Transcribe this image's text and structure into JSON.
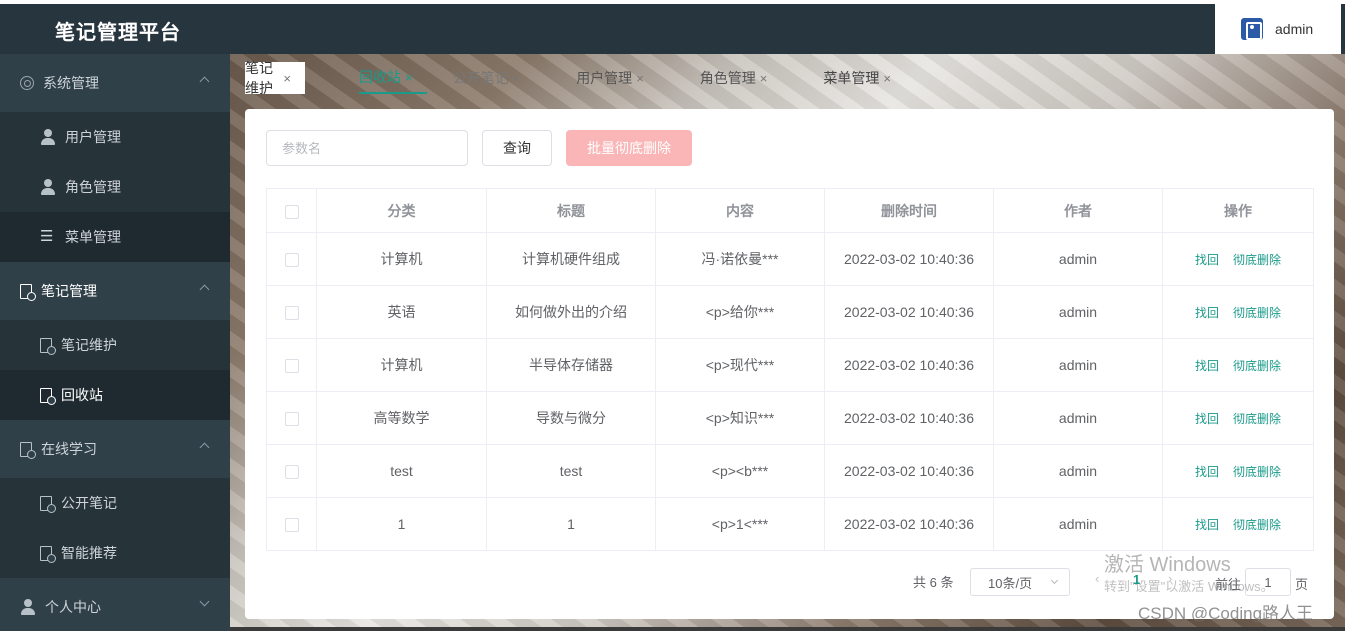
{
  "header": {
    "title": "笔记管理平台",
    "user": "admin"
  },
  "sidebar": {
    "groups": [
      {
        "label": "系统管理",
        "icon": "gear-icon",
        "expanded": true,
        "items": [
          {
            "label": "用户管理",
            "icon": "user-icon"
          },
          {
            "label": "角色管理",
            "icon": "role-icon"
          },
          {
            "label": "菜单管理",
            "icon": "menu-list-icon"
          }
        ]
      },
      {
        "label": "笔记管理",
        "icon": "note-icon",
        "expanded": true,
        "items": [
          {
            "label": "笔记维护",
            "icon": "note-icon"
          },
          {
            "label": "回收站",
            "icon": "note-icon",
            "selected": true
          }
        ]
      },
      {
        "label": "在线学习",
        "icon": "doc-icon",
        "expanded": true,
        "items": [
          {
            "label": "公开笔记",
            "icon": "note-icon"
          },
          {
            "label": "智能推荐",
            "icon": "note-icon"
          }
        ]
      },
      {
        "label": "个人中心",
        "icon": "user-icon",
        "expanded": false,
        "items": []
      }
    ]
  },
  "tabs": [
    {
      "label": "笔记维护"
    },
    {
      "label": "回收站",
      "active": true
    },
    {
      "label": "公开笔记"
    },
    {
      "label": "用户管理"
    },
    {
      "label": "角色管理"
    },
    {
      "label": "菜单管理"
    }
  ],
  "toolbar": {
    "search_placeholder": "参数名",
    "query_label": "查询",
    "batch_delete_label": "批量彻底删除"
  },
  "table": {
    "columns": [
      "分类",
      "标题",
      "内容",
      "删除时间",
      "作者",
      "操作"
    ],
    "rows": [
      {
        "category": "计算机",
        "title": "计算机硬件组成",
        "content": "冯·诺依曼***",
        "deleted_at": "2022-03-02 10:40:36",
        "author": "admin"
      },
      {
        "category": "英语",
        "title": "如何做外出的介绍",
        "content": "<p>给你***",
        "deleted_at": "2022-03-02 10:40:36",
        "author": "admin"
      },
      {
        "category": "计算机",
        "title": "半导体存储器",
        "content": "<p>现代***",
        "deleted_at": "2022-03-02 10:40:36",
        "author": "admin"
      },
      {
        "category": "高等数学",
        "title": "导数与微分",
        "content": "<p>知识***",
        "deleted_at": "2022-03-02 10:40:36",
        "author": "admin"
      },
      {
        "category": "test",
        "title": "test",
        "content": "<p><b***",
        "deleted_at": "2022-03-02 10:40:36",
        "author": "admin"
      },
      {
        "category": "1",
        "title": "1",
        "content": "<p>1<***",
        "deleted_at": "2022-03-02 10:40:36",
        "author": "admin"
      }
    ],
    "actions": {
      "restore": "找回",
      "purge": "彻底删除"
    }
  },
  "pagination": {
    "total_text": "共 6 条",
    "page_size": "10条/页",
    "current_page": "1",
    "goto_label": "前往",
    "goto_value": "1",
    "page_suffix": "页"
  },
  "watermarks": {
    "activate_title": "激活 Windows",
    "activate_sub": "转到\"设置\"以激活 Windows。",
    "csdn": "CSDN @Coding路人王"
  },
  "colors": {
    "accent": "#1a9a8a",
    "sidebar_bg": "#304049",
    "header_bg": "#27353f",
    "batch_btn": "#fab6b6"
  }
}
